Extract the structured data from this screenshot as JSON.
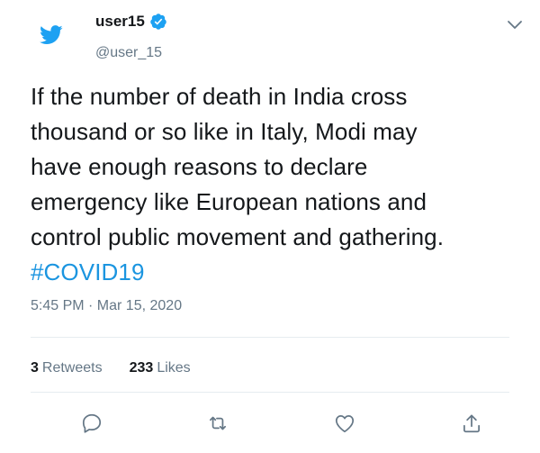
{
  "user": {
    "display_name": "user15",
    "handle": "@user_15",
    "verified": true
  },
  "tweet": {
    "text_lines": [
      "If the number of death in India cross",
      "thousand or so like in Italy, Modi may",
      "have enough reasons to declare",
      "emergency like European nations and",
      "control public movement and gathering."
    ],
    "hashtag": "#COVID19",
    "timestamp": "5:45 PM · Mar 15, 2020"
  },
  "stats": {
    "retweets_count": "3",
    "retweets_label": "Retweets",
    "likes_count": "233",
    "likes_label": "Likes"
  },
  "icons": {
    "logo": "twitter-bird-icon",
    "verified": "verified-badge-icon",
    "caret": "chevron-down-icon",
    "reply": "reply-icon",
    "retweet": "retweet-icon",
    "like": "heart-icon",
    "share": "share-icon"
  },
  "colors": {
    "brand": "#1da1f2",
    "hashtag": "#1b95e0",
    "text": "#14171a",
    "secondary": "#657786",
    "divider": "#e6ecf0"
  }
}
